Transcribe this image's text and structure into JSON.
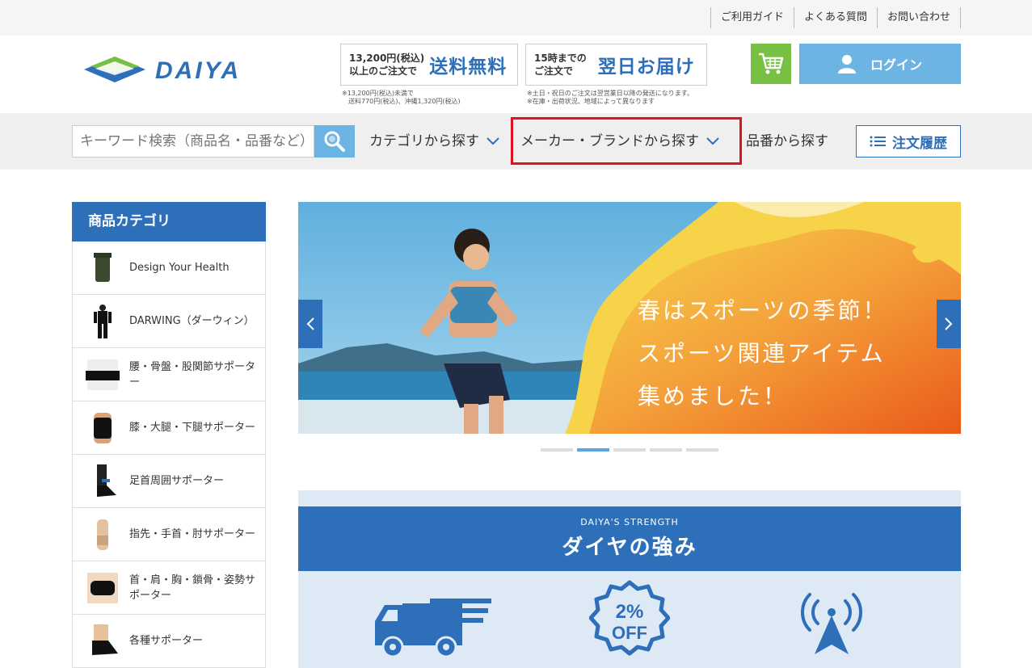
{
  "utility_links": [
    "ご利用ガイド",
    "よくある質問",
    "お問い合わせ"
  ],
  "brand": {
    "name": "DAIYA",
    "primary_color": "#2e6fba",
    "accent_green": "#78c043"
  },
  "promos": [
    {
      "small_line1": "13,200円(税込)",
      "small_line2": "以上のご注文で",
      "big": "送料無料",
      "note_line1": "※13,200円(税込)未満で",
      "note_line2": "送料770円(税込)、沖縄1,320円(税込)"
    },
    {
      "small_line1": "15時までの",
      "small_line2": "ご注文で",
      "big": "翌日お届け",
      "note_line1": "※土日・祝日のご注文は翌営業日以降の発送になります。",
      "note_line2": "※在庫・出荷状況、地域によって異なります"
    }
  ],
  "header": {
    "cart_icon": "cart-icon",
    "login_label": "ログイン"
  },
  "nav": {
    "search_placeholder": "キーワード検索（商品名・品番など）",
    "category": "カテゴリから探す",
    "brand": "メーカー・ブランドから探す",
    "part_number": "品番から探す",
    "order_history": "注文履歴"
  },
  "sidebar": {
    "title": "商品カテゴリ",
    "items": [
      {
        "label": "Design Your Health"
      },
      {
        "label": "DARWING（ダーウィン）"
      },
      {
        "label": "腰・骨盤・股関節サポーター"
      },
      {
        "label": "膝・大腿・下腿サポーター"
      },
      {
        "label": "足首周囲サポーター"
      },
      {
        "label": "指先・手首・肘サポーター"
      },
      {
        "label": "首・肩・胸・鎖骨・姿勢サポーター"
      },
      {
        "label": "各種サポーター"
      }
    ]
  },
  "banner": {
    "line1": "春はスポーツの季節！",
    "line2": "スポーツ関連アイテム",
    "line3": "集めました！",
    "slide_count": 5,
    "active_slide": 2
  },
  "strength": {
    "subtitle": "DAIYA'S STRENGTH",
    "title": "ダイヤの強み",
    "badge_top": "2%",
    "badge_bottom": "OFF"
  }
}
